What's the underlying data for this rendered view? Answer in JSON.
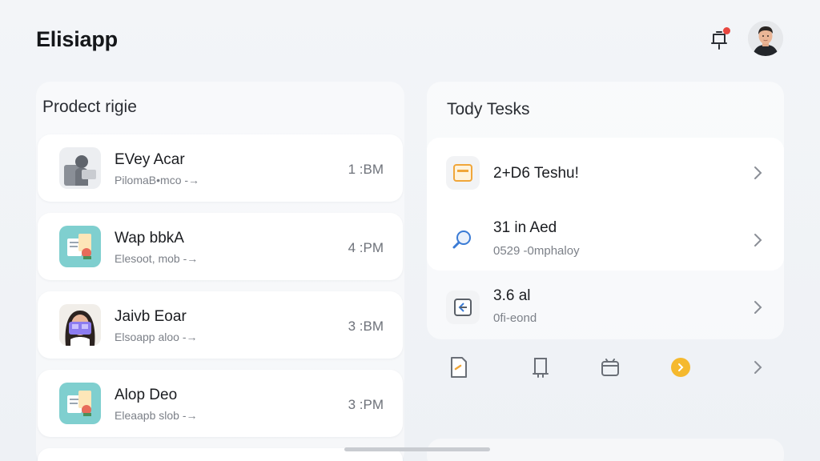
{
  "header": {
    "app_title": "Elisiapp",
    "bell_icon": "bell-icon",
    "notification_color": "#e8473f"
  },
  "left_panel": {
    "title": "Prodect rigie",
    "items": [
      {
        "name": "EVey Acar",
        "sub": "PilomaB•mco -→",
        "time": "1 :BM",
        "icon": "person-laptop-icon"
      },
      {
        "name": "Wap bbkA",
        "sub": "Elesoot, mob -→",
        "time": "4 :PM",
        "icon": "documents-icon"
      },
      {
        "name": "Jaivb Eoar",
        "sub": "Elsoapp aloo -→",
        "time": "3 :BM",
        "icon": "woman-avatar-icon"
      },
      {
        "name": "Alop Deo",
        "sub": "Eleaapb slob -→",
        "time": "3 :PM",
        "icon": "documents-icon"
      }
    ]
  },
  "right_panel": {
    "title": "Tody Tesks",
    "tasks": [
      {
        "name": "2+D6 Teshu!",
        "sub": "",
        "icon": "calendar-icon"
      },
      {
        "name": "31 in Aed",
        "sub": "0529 -0mphaloy",
        "icon": "search-icon"
      },
      {
        "name": "3.6 al",
        "sub": "0fi-eond",
        "icon": "document-edit-icon"
      }
    ]
  },
  "bottom_icons": [
    "note-icon",
    "bookmark-icon",
    "archive-icon",
    "badge-icon",
    "chevron-right-icon"
  ],
  "accent_colors": {
    "orange": "#f0a63a",
    "teal": "#7fcfcf",
    "purple": "#8c7cf0",
    "yellow": "#f5b92e"
  }
}
